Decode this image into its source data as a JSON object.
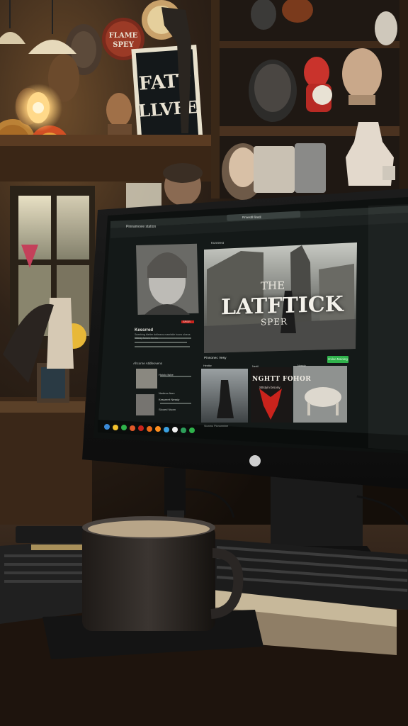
{
  "scene": {
    "wall_sign": {
      "line1": "FATT",
      "line2": "LLVFE"
    },
    "round_sign": {
      "line1": "FLAME",
      "line2": "SPEY"
    }
  },
  "screen": {
    "window_title": "Pinnamovie station",
    "address_bar": "Rmestll filmtll",
    "hero": {
      "top_word": "THE",
      "title": "LATFTICK",
      "subtitle": "SPER",
      "section_label": "Kunreest"
    },
    "profile": {
      "name": "Kessrred",
      "tag": "SPER",
      "description": "Sneeking bletter dofimecs maerlatle hoors sloeos fittiesiy forsen ho ms",
      "section": "Ahcorne Atldleovens"
    },
    "list_items": [
      {
        "title": "Hoiolo lishe",
        "meta": "Nodecc Aorc"
      },
      {
        "title": "Kessrerrt Nessiy",
        "meta": "Slooed Nsom"
      }
    ],
    "row_label": "Pinsonec Vesy",
    "row_action": "Hvloo Nsioing",
    "cards": [
      {
        "label": "Hesttw",
        "title": ""
      },
      {
        "label": "Nertil",
        "title": "NGHTT FOHOR",
        "sub": "Sttstyin brsoriy"
      },
      {
        "label": "Nessty",
        "title": ""
      }
    ],
    "taskbar_label": "Stonmo Plonomnine"
  },
  "colors": {
    "accent_green": "#2fb24b",
    "accent_red": "#c9231c",
    "screen_bg": "#151a19",
    "warm_light": "#ffcf7a"
  }
}
